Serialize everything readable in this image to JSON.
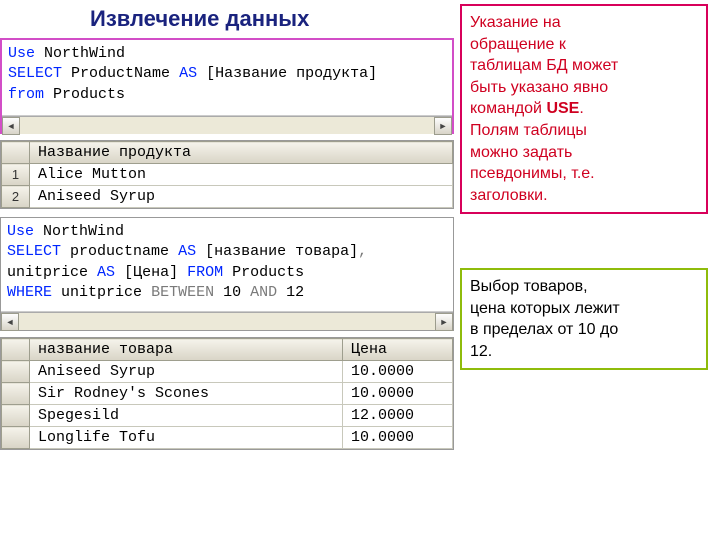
{
  "title": "Извлечение данных",
  "callout1": {
    "l1": "Указание на",
    "l2": "обращение к",
    "l3": "таблицам БД может",
    "l4": "быть указано явно",
    "l5_a": "командой ",
    "l5_b": "USE",
    "l5_c": ".",
    "l6": "Полям таблицы",
    "l7": "можно задать",
    "l8": "псевдонимы, т.е.",
    "l9": "заголовки."
  },
  "callout2": {
    "l1": "Выбор товаров,",
    "l2": "цена которых лежит",
    "l3": "в пределах от 10 до",
    "l4": "12."
  },
  "sql1": {
    "w_use": "Use",
    "db": "NorthWind",
    "w_select": "SELECT",
    "col": "ProductName",
    "w_as": "AS",
    "alias": "[Название продукта]",
    "w_from": "from",
    "table": "Products"
  },
  "res1": {
    "head": "Название продукта",
    "rows": [
      "Alice Mutton",
      "Aniseed Syrup"
    ],
    "rn": [
      "1",
      "2"
    ]
  },
  "sql2": {
    "w_use": "Use",
    "db": "NorthWind",
    "w_select": "SELECT",
    "c1": "productname",
    "w_as1": "AS",
    "a1": "[название товара]",
    "c2": "unitprice",
    "w_as2": "AS",
    "a2": "[Цена]",
    "w_from": "FROM",
    "table": "Products",
    "w_where": "WHERE",
    "cond_col": "unitprice",
    "w_between": "BETWEEN",
    "v1": "10",
    "w_and": "AND",
    "v2": "12"
  },
  "res2": {
    "h1": "название товара",
    "h2": "Цена",
    "rows": [
      {
        "name": "Aniseed Syrup",
        "price": "10.0000"
      },
      {
        "name": "Sir Rodney's Scones",
        "price": "10.0000"
      },
      {
        "name": "Spegesild",
        "price": "12.0000"
      },
      {
        "name": "Longlife Tofu",
        "price": "10.0000"
      }
    ]
  }
}
